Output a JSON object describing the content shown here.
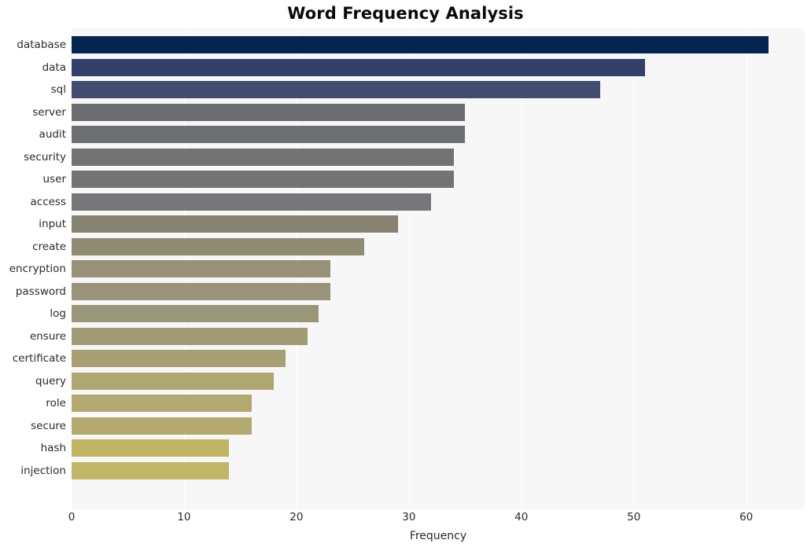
{
  "chart_data": {
    "type": "bar",
    "orientation": "horizontal",
    "title": "Word Frequency Analysis",
    "xlabel": "Frequency",
    "ylabel": "",
    "xlim": [
      0,
      65.2
    ],
    "xticks": [
      0,
      10,
      20,
      30,
      40,
      50,
      60
    ],
    "xticklabels": [
      "0",
      "10",
      "20",
      "30",
      "40",
      "50",
      "60"
    ],
    "grid": true,
    "grid_axis": "x",
    "legend": null,
    "categories": [
      "database",
      "data",
      "sql",
      "server",
      "audit",
      "security",
      "user",
      "access",
      "input",
      "create",
      "encryption",
      "password",
      "log",
      "ensure",
      "certificate",
      "query",
      "role",
      "secure",
      "hash",
      "injection"
    ],
    "values": [
      62,
      51,
      47,
      35,
      35,
      34,
      34,
      32,
      29,
      26,
      23,
      23,
      22,
      21,
      19,
      18,
      16,
      16,
      14,
      14
    ],
    "bar_colors": [
      "#042552",
      "#33406c",
      "#414c6f",
      "#6d6e72",
      "#6e6f73",
      "#727275",
      "#737376",
      "#77777a",
      "#85836f",
      "#908c72",
      "#979277",
      "#98937a",
      "#9b9678",
      "#a19b75",
      "#a89f72",
      "#b0a66f",
      "#b3a96f",
      "#b4aa6f",
      "#c0b363",
      "#c2b565"
    ],
    "plot_bg": "#f7f7f8",
    "figure_bg": "#ffffff",
    "gridline_color": "#ffffff",
    "title_color": "#0a0a0a",
    "tick_color": "#2a2a2a"
  },
  "axis": {
    "x_label": "Frequency"
  }
}
